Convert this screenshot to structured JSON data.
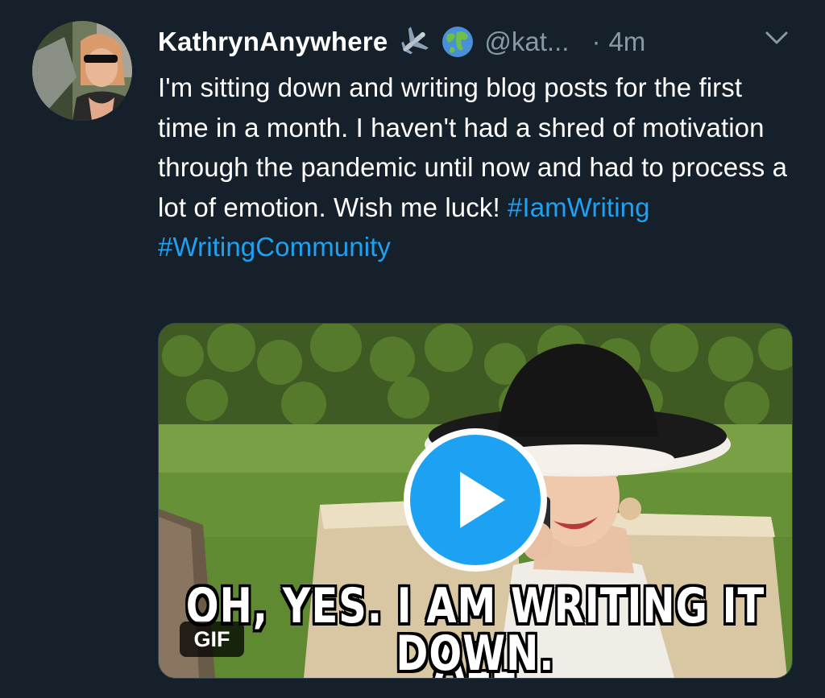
{
  "tweet": {
    "display_name": "KathrynAnywhere",
    "name_emojis": [
      "airplane-emoji",
      "globe-emoji"
    ],
    "handle": "@kat...",
    "separator": "·",
    "time": "4m",
    "text_plain": "I'm sitting down and writing blog posts for the first time in a month. I haven't had a shred of motivation through the pandemic until now and had to process a lot of emotion. Wish me luck! ",
    "hashtags": [
      "#IamWriting",
      "#WritingCommunity"
    ],
    "menu_icon": "chevron-down-icon"
  },
  "media": {
    "caption_line1": "OH, YES. I AM WRITING IT ALL",
    "caption_line2": "DOWN.",
    "badge": "GIF",
    "play_icon": "play-icon",
    "accent": "#1da1f2"
  },
  "colors": {
    "background": "#15202b",
    "text": "#ffffff",
    "muted": "#8899a6",
    "link": "#1da1f2"
  }
}
